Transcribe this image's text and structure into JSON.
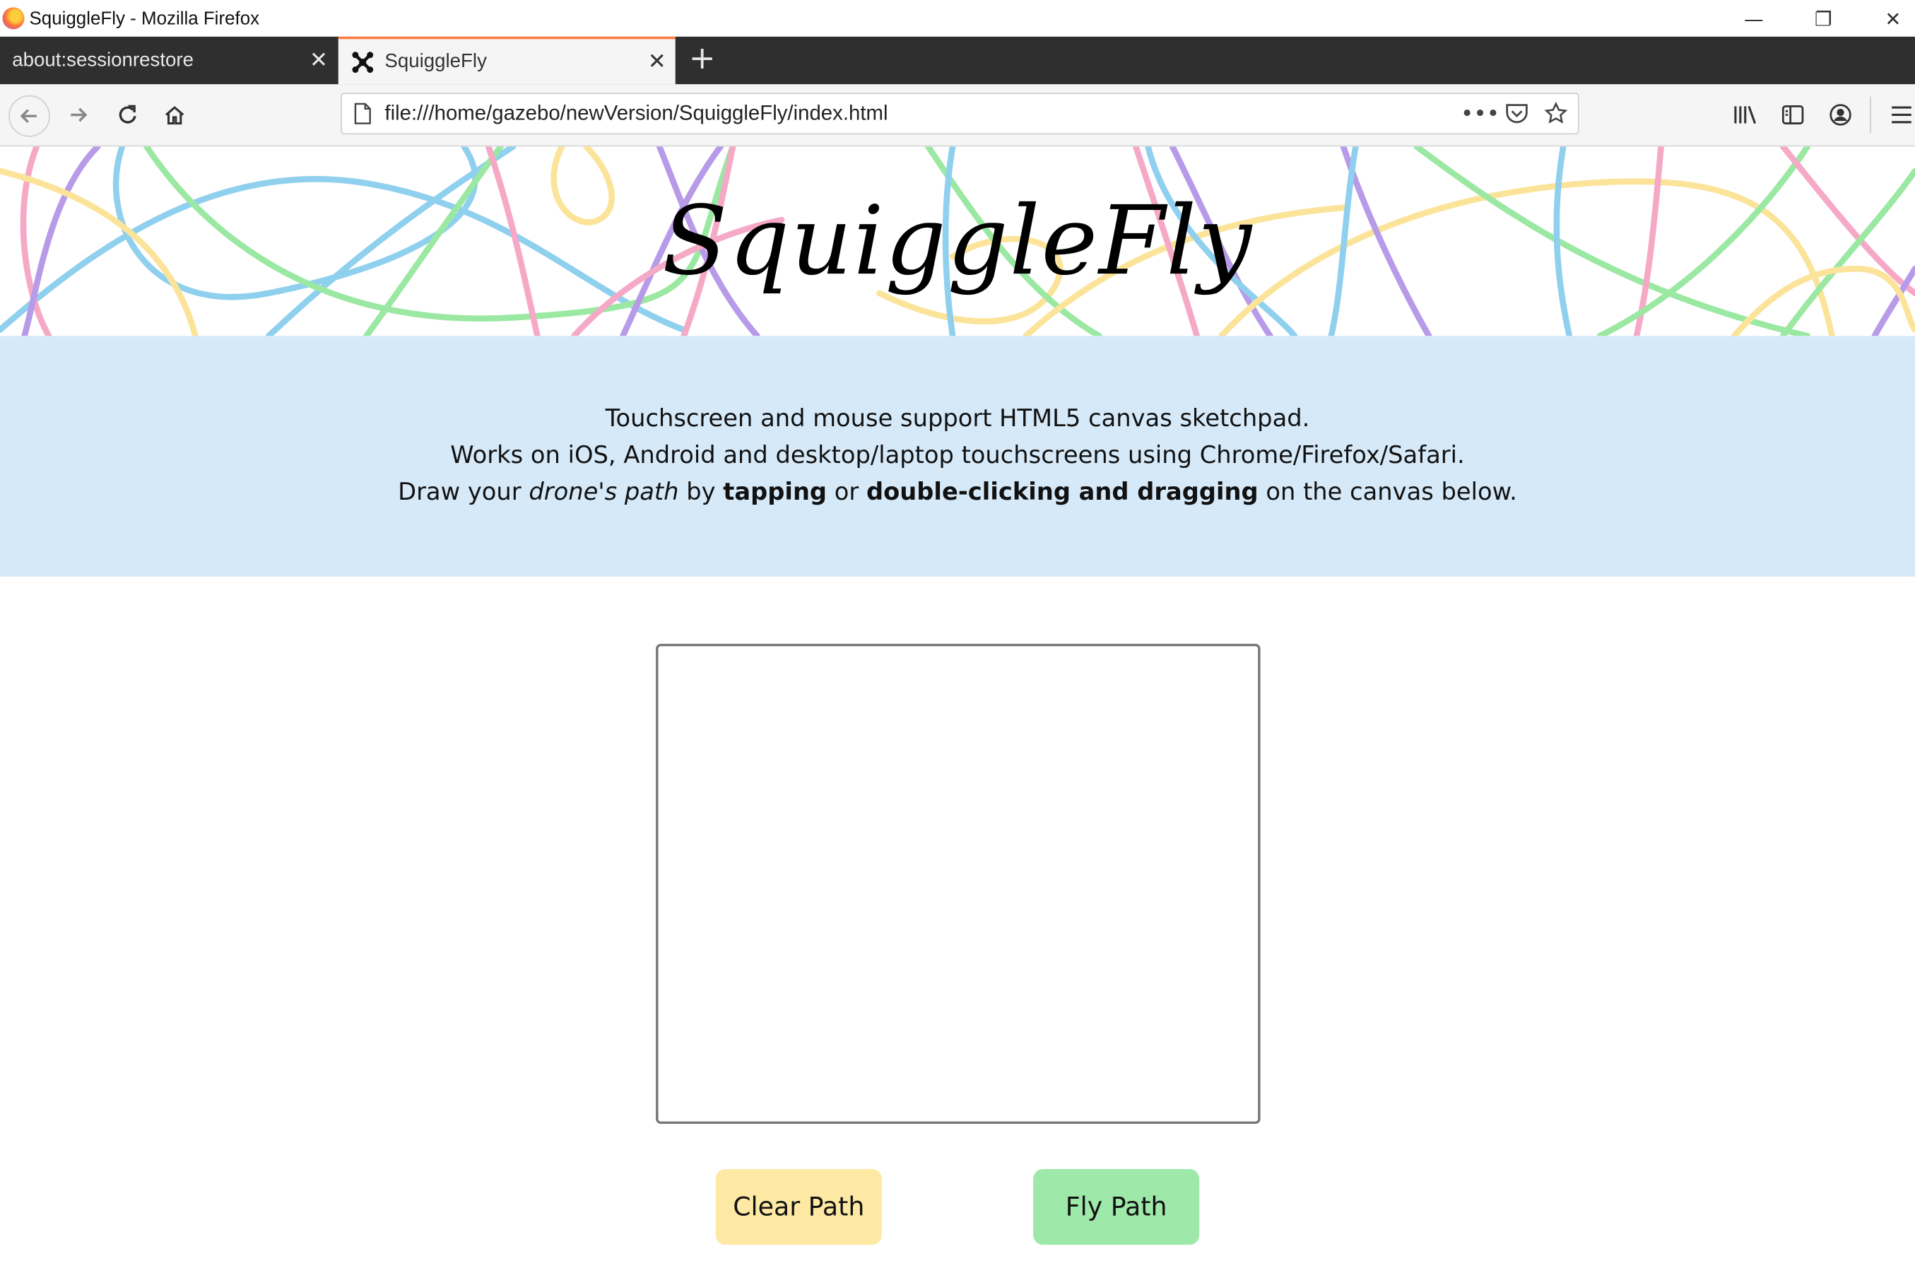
{
  "window": {
    "title": "SquiggleFly - Mozilla Firefox",
    "controls": {
      "minimize": "—",
      "restore": "❐",
      "close": "✕"
    }
  },
  "tabs": [
    {
      "label": "about:sessionrestore",
      "active": false
    },
    {
      "label": "SquiggleFly",
      "active": true,
      "icon": "drone-icon"
    }
  ],
  "newtab_label": "+",
  "navbar": {
    "url": "file:///home/gazebo/newVersion/SquiggleFly/index.html",
    "icons": [
      "back-icon",
      "forward-icon",
      "reload-icon",
      "home-icon",
      "page-icon",
      "more-icon",
      "pocket-icon",
      "star-icon",
      "library-icon",
      "sidebar-icon",
      "account-icon",
      "menu-icon"
    ]
  },
  "header": {
    "brand": "SquiggleFly",
    "squiggle_colors": [
      "#8fd0ee",
      "#9be8a3",
      "#fbe49a",
      "#f5a9c7",
      "#b79be8"
    ]
  },
  "info": {
    "line1": "Touchscreen and mouse support HTML5 canvas sketchpad.",
    "line2": "Works on iOS, Android and desktop/laptop touchscreens using Chrome/Firefox/Safari.",
    "line3_a": "Draw your ",
    "line3_em": "drone's path",
    "line3_b": " by ",
    "line3_strong1": "tapping",
    "line3_c": " or ",
    "line3_strong2": "double-clicking and dragging",
    "line3_d": " on the canvas below."
  },
  "actions": {
    "clear_label": "Clear Path",
    "fly_label": "Fly Path"
  },
  "colors": {
    "info_bg": "#d6e9f8",
    "clear_bg": "#fde9a4",
    "fly_bg": "#9ee8a9",
    "tab_accent": "#ff7a3d",
    "tabstrip_bg": "#2f2f2f"
  }
}
